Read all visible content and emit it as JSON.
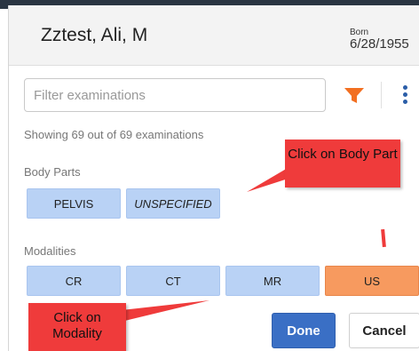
{
  "patient": {
    "name": "Zztest, Ali, M",
    "born_label": "Born",
    "born_date": "6/28/1955"
  },
  "filter": {
    "placeholder": "Filter examinations",
    "value": ""
  },
  "status": {
    "showing": "Showing 69 out of 69 examinations"
  },
  "body_parts": {
    "label": "Body Parts",
    "items": [
      {
        "label": "PELVIS",
        "selected": false
      },
      {
        "label": "UNSPECIFIED",
        "selected": false
      }
    ]
  },
  "modalities": {
    "label": "Modalities",
    "items": [
      {
        "label": "CR",
        "selected": false
      },
      {
        "label": "CT",
        "selected": false
      },
      {
        "label": "MR",
        "selected": false
      },
      {
        "label": "US",
        "selected": true
      }
    ]
  },
  "actions": {
    "done": "Done",
    "cancel": "Cancel"
  },
  "annotations": {
    "body_part_callout": "Click on Body Part",
    "modality_callout": "Click on Modality"
  },
  "colors": {
    "chip": "#b9d2f5",
    "chip_selected": "#f79a5f",
    "done_button": "#3a6fc5",
    "funnel_icon": "#f26f21",
    "kebab_icon": "#2b5ea8",
    "callout": "#ef3b3b"
  },
  "icons": {
    "filter": "funnel-icon",
    "menu": "kebab-menu-icon"
  }
}
